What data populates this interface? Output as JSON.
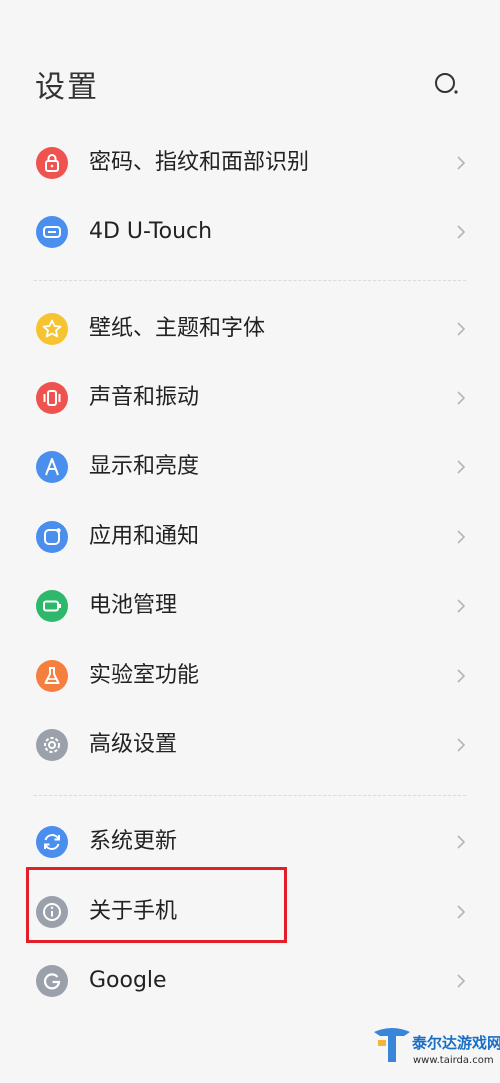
{
  "header": {
    "title": "设置"
  },
  "icons": {
    "search": "search-icon",
    "chevron": "chevron-right-icon"
  },
  "items": [
    {
      "label": "密码、指纹和面部识别",
      "icon": "lock-icon",
      "color": "#ef5350"
    },
    {
      "label": "4D U-Touch",
      "icon": "touch-icon",
      "color": "#4a8fee"
    },
    {
      "label": "壁纸、主题和字体",
      "icon": "star-icon",
      "color": "#f7c431"
    },
    {
      "label": "声音和振动",
      "icon": "vibration-icon",
      "color": "#ef5350"
    },
    {
      "label": "显示和亮度",
      "icon": "display-icon",
      "color": "#4a8fee"
    },
    {
      "label": "应用和通知",
      "icon": "apps-icon",
      "color": "#4a8fee"
    },
    {
      "label": "电池管理",
      "icon": "battery-icon",
      "color": "#2eb86b"
    },
    {
      "label": "实验室功能",
      "icon": "flask-icon",
      "color": "#f47f3f"
    },
    {
      "label": "高级设置",
      "icon": "gear-icon",
      "color": "#9aa1ab"
    },
    {
      "label": "系统更新",
      "icon": "update-icon",
      "color": "#4a8fee"
    },
    {
      "label": "关于手机",
      "icon": "info-icon",
      "color": "#9aa1ab"
    },
    {
      "label": "Google",
      "icon": "google-icon",
      "color": "#9aa1ab"
    }
  ],
  "highlight": {
    "target": "关于手机",
    "color": "#e21f26"
  },
  "watermark": {
    "name": "泰尔达游戏网",
    "url": "www.tairda.com"
  }
}
